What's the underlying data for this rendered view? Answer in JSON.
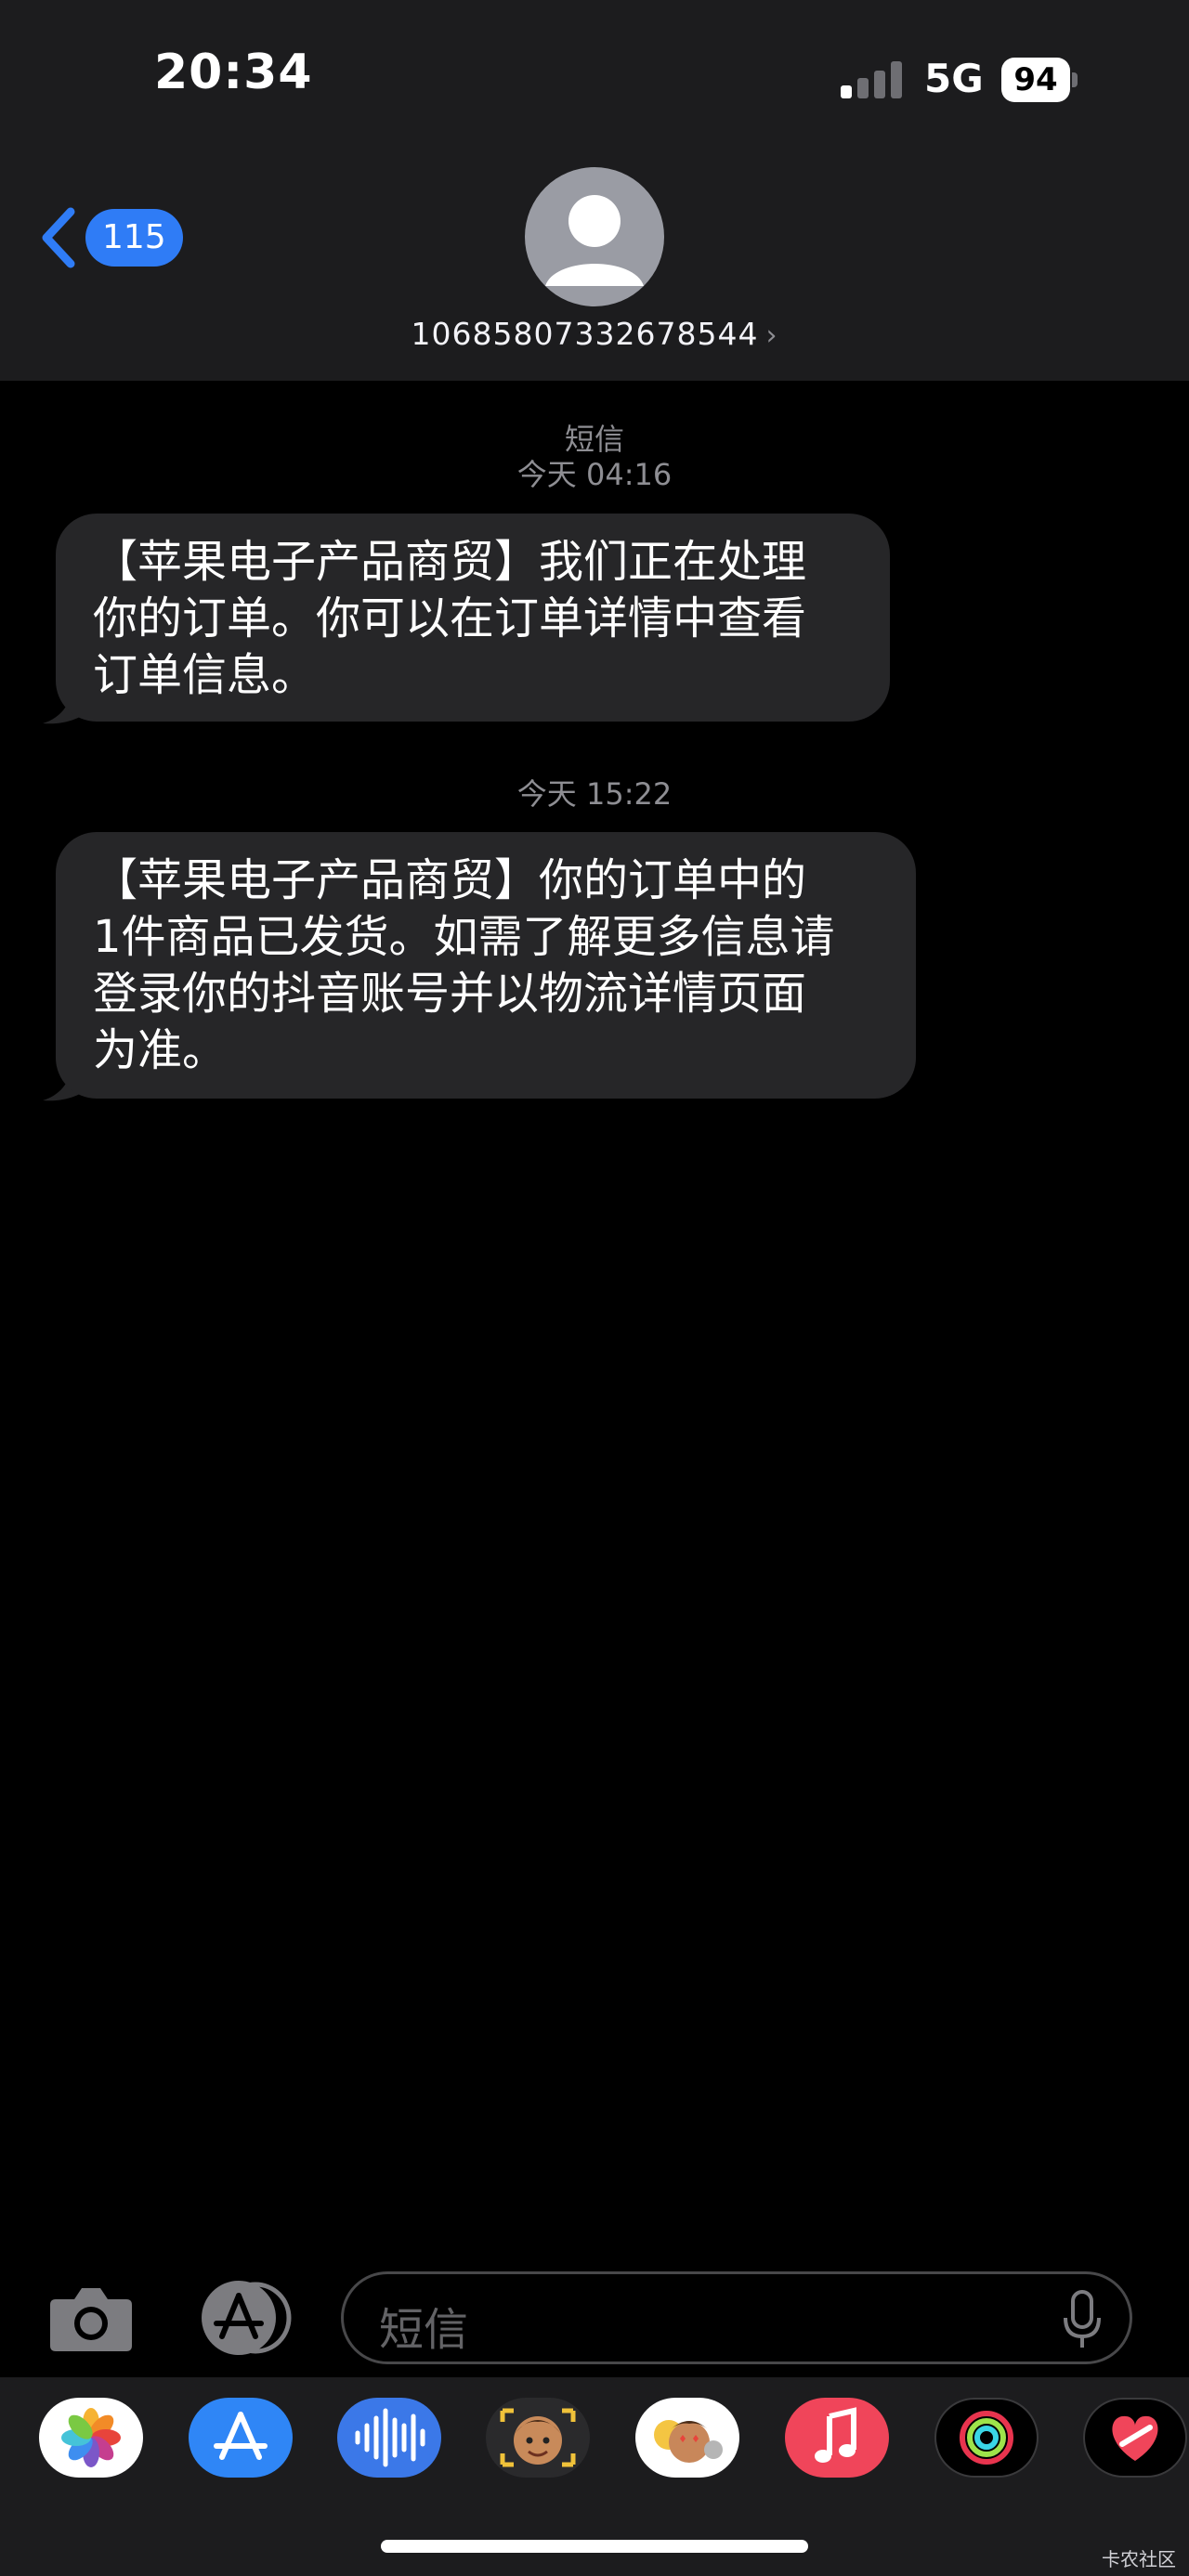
{
  "status": {
    "time": "20:34",
    "network": "5G",
    "battery": "94"
  },
  "header": {
    "back_count": "115",
    "contact": "10685807332678544"
  },
  "thread": {
    "service_label": "短信",
    "timestamp_1": "今天 04:16",
    "message_1": "【苹果电子产品商贸】我们正在处理\n你的订单。你可以在订单详情中查看\n订单信息。",
    "timestamp_2": "今天 15:22",
    "message_2": "【苹果电子产品商贸】你的订单中的\n1件商品已发货。如需了解更多信息请\n登录你的抖音账号并以物流详情页面\n为准。"
  },
  "input": {
    "placeholder": "短信"
  },
  "colors": {
    "accent": "#2f7cf6",
    "bubble": "#262628",
    "header_bg": "#1c1c1e"
  },
  "app_drawer": [
    "photos-icon",
    "app-store-icon",
    "audio-message-icon",
    "memoji-icon",
    "animoji-stickers-icon",
    "music-icon",
    "fitness-icon",
    "digital-touch-icon"
  ],
  "watermark": "卡农社区"
}
